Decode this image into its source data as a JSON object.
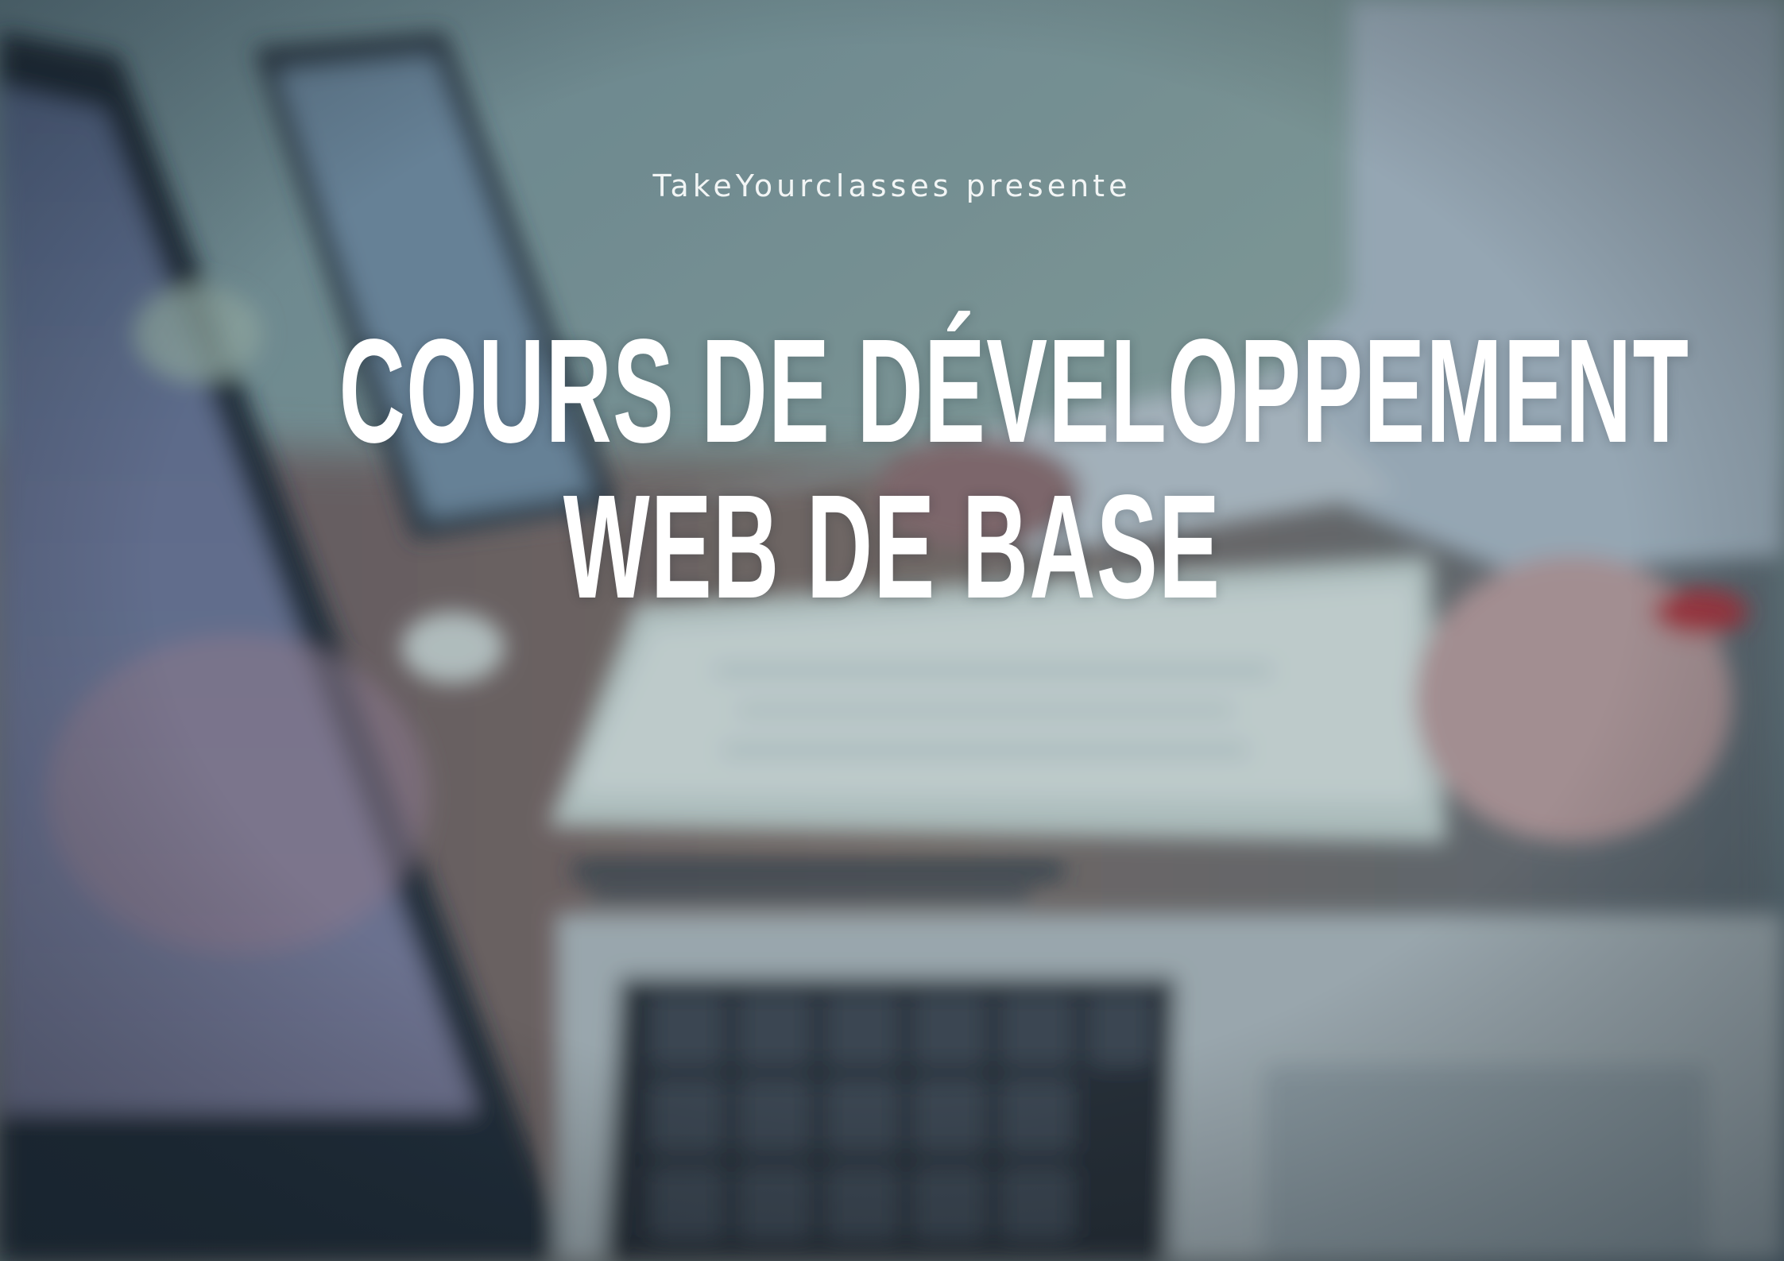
{
  "cover": {
    "presenter": "TakeYourclasses presente",
    "title_line_1": "Cours de développement",
    "title_line_2": "web de base",
    "text_color": "#ffffff",
    "background_tint": "#5f7a86"
  }
}
